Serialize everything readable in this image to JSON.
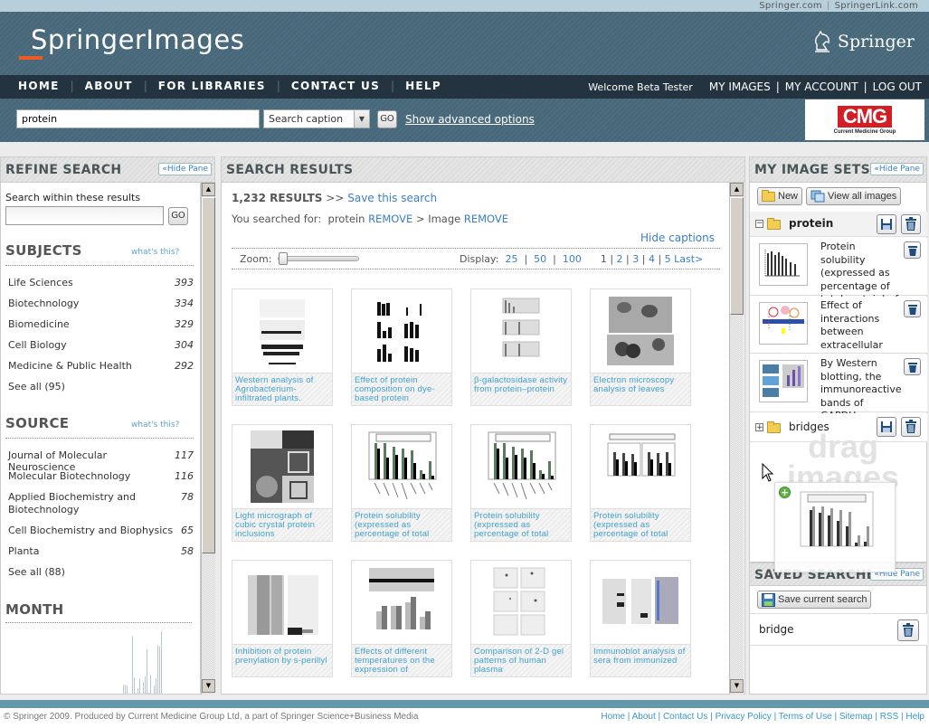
{
  "topbar": {
    "links": [
      "Springer.com",
      "SpringerLink.com"
    ]
  },
  "header": {
    "logo": "SpringerImages",
    "partner_logo": "Springer"
  },
  "nav": {
    "items": [
      "HOME",
      "ABOUT",
      "FOR LIBRARIES",
      "CONTACT US",
      "HELP"
    ],
    "welcome": "Welcome Beta Tester",
    "user_links": [
      "MY IMAGES",
      "MY ACCOUNT",
      "LOG OUT"
    ]
  },
  "search": {
    "query": "protein",
    "scope": "Search caption",
    "go": "GO",
    "advanced": "Show advanced options",
    "sponsor_big": "CMG",
    "sponsor_small": "Current Medicine Group"
  },
  "refine": {
    "title": "REFINE SEARCH",
    "hide": "«Hide Pane",
    "within_label": "Search within these results",
    "within_value": "",
    "go": "GO",
    "whats_this": "what's this?",
    "subjects_title": "SUBJECTS",
    "subjects": [
      {
        "name": "Life Sciences",
        "count": "393"
      },
      {
        "name": "Biotechnology",
        "count": "334"
      },
      {
        "name": "Biomedicine",
        "count": "329"
      },
      {
        "name": "Cell Biology",
        "count": "304"
      },
      {
        "name": "Medicine & Public Health",
        "count": "292"
      }
    ],
    "subjects_see_all": "See all (95)",
    "source_title": "SOURCE",
    "sources": [
      {
        "name": "Journal of Molecular Neuroscience",
        "count": "117"
      },
      {
        "name": "Molecular Biotechnology",
        "count": "116"
      },
      {
        "name": "Applied Biochemistry and Biotechnology",
        "count": "78"
      },
      {
        "name": "Cell Biochemistry and Biophysics",
        "count": "65"
      },
      {
        "name": "Planta",
        "count": "58"
      }
    ],
    "sources_see_all": "See all (88)",
    "month_title": "MONTH",
    "month_histogram": [
      2,
      2,
      1.8,
      0,
      0,
      12,
      3.5,
      0.3,
      1.3,
      3.2,
      0,
      2.6,
      3.7,
      9.3,
      0.4,
      4,
      0,
      1.9,
      3.3,
      10.2,
      9.9,
      13
    ]
  },
  "results": {
    "title": "SEARCH RESULTS",
    "count": "1,232 RESULTS",
    "arrow": ">>",
    "save_search": "Save this search",
    "searched_for": "You searched for:",
    "terms": [
      {
        "term": "protein",
        "remove": "REMOVE"
      },
      {
        "term": "Image",
        "remove": "REMOVE"
      }
    ],
    "crumb_sep": ">",
    "hide_captions": "Hide captions",
    "zoom_label": "Zoom:",
    "zoom_value": 0,
    "display_label": "Display:",
    "display_options": [
      "25",
      "50",
      "100"
    ],
    "pages": [
      "1",
      "2",
      "3",
      "4",
      "5"
    ],
    "last": "Last>",
    "items": [
      {
        "caption": "Western analysis of Agrobacterium-infiltrated plants.",
        "kind": "blot"
      },
      {
        "caption": "Effect of protein composition on dye-based protein",
        "kind": "bars6"
      },
      {
        "caption": "β-galactosidase activity from protein–protein",
        "kind": "bars3"
      },
      {
        "caption": "Electron microscopy analysis of leaves",
        "kind": "micro"
      },
      {
        "caption": "Light micrograph of cubic crystal protein inclusions",
        "kind": "crystal"
      },
      {
        "caption": "Protein solubility (expressed as percentage of total",
        "kind": "barchart"
      },
      {
        "caption": "Protein solubility (expressed as percentage of total",
        "kind": "barchart"
      },
      {
        "caption": "Protein solubility (expressed as percentage of total",
        "kind": "barchart2"
      },
      {
        "caption": "Inhibition of protein prenylation by s-perillyl",
        "kind": "gel"
      },
      {
        "caption": "Effects of different temperatures on the expression of",
        "kind": "mixed"
      },
      {
        "caption": "Comparison of 2-D gel patterns of human plasma",
        "kind": "gel2d"
      },
      {
        "caption": "Immunoblot analysis of sera from immunized",
        "kind": "immuno"
      }
    ]
  },
  "image_sets": {
    "title": "MY IMAGE SETS",
    "hide": "«Hide Pane",
    "new": "New",
    "view_all": "View all images",
    "sets": [
      {
        "name": "protein",
        "expanded": true,
        "images": [
          {
            "caption": "Protein solubility (expressed as percentage of total protein) of"
          },
          {
            "caption": "Effect of interactions between extracellular"
          },
          {
            "caption": "By Western blotting, the immunoreactive bands of GAPDH"
          }
        ]
      },
      {
        "name": "bridges",
        "expanded": false,
        "images": []
      }
    ],
    "drop_hint": "drag images"
  },
  "saved_searches": {
    "title": "SAVED SEARCHES",
    "hide": "«Hide Pane",
    "save_current": "Save current search",
    "items": [
      "bridge"
    ]
  },
  "footer": {
    "copyright": "© Springer 2009. Produced by Current Medicine Group Ltd, a part of Springer Science+Business Media",
    "links": [
      "Home",
      "About",
      "Contact Us",
      "Privacy Policy",
      "Terms of Use",
      "Sitemap",
      "RSS",
      "Help"
    ]
  }
}
